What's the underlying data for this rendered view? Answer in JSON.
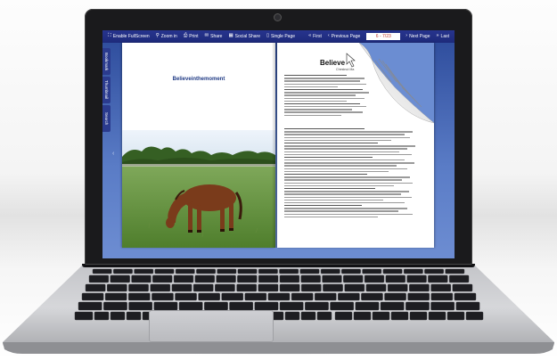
{
  "toolbar": {
    "left_buttons": [
      {
        "label": "Enable FullScreen",
        "icon": "fullscreen-icon",
        "glyph": "⛶"
      },
      {
        "label": "Zoom in",
        "icon": "zoom-in-icon",
        "glyph": "⚲"
      },
      {
        "label": "Print",
        "icon": "print-icon",
        "glyph": "⎙"
      },
      {
        "label": "Share",
        "icon": "mail-icon",
        "glyph": "✉"
      },
      {
        "label": "Social Share",
        "icon": "social-share-icon",
        "glyph": "▦"
      },
      {
        "label": "Single Page",
        "icon": "single-page-icon",
        "glyph": "▯"
      }
    ],
    "first_label": "First",
    "previous_label": "Previous Page",
    "page_value": "6 - 7/23",
    "next_label": "Next Page",
    "last_label": "Last"
  },
  "side_tabs": [
    "Bookmark",
    "Thumbnail",
    "Search"
  ],
  "book": {
    "left_title": "Believeinthemoment",
    "right_title": "Believe",
    "right_subtitle": "Chestnut Ma"
  },
  "colors": {
    "toolbar": "#1d2a7a",
    "screen_background": "#5a7cc6",
    "left_title": "#1f3a84",
    "page_field_text": "#c0392b"
  }
}
